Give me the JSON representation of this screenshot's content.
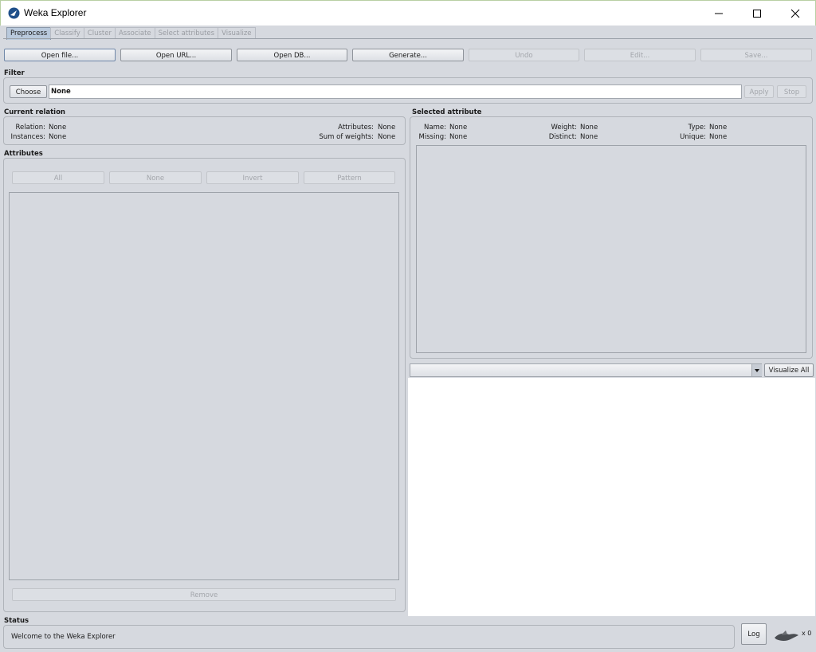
{
  "window": {
    "title": "Weka Explorer"
  },
  "tabs": [
    {
      "label": "Preprocess"
    },
    {
      "label": "Classify"
    },
    {
      "label": "Cluster"
    },
    {
      "label": "Associate"
    },
    {
      "label": "Select attributes"
    },
    {
      "label": "Visualize"
    }
  ],
  "toolbar": {
    "open_file": "Open file...",
    "open_url": "Open URL...",
    "open_db": "Open DB...",
    "generate": "Generate...",
    "undo": "Undo",
    "edit": "Edit...",
    "save": "Save..."
  },
  "filter": {
    "label": "Filter",
    "choose": "Choose",
    "value": "None",
    "apply": "Apply",
    "stop": "Stop"
  },
  "current_relation": {
    "label": "Current relation",
    "relation_label": "Relation:",
    "relation_value": "None",
    "instances_label": "Instances:",
    "instances_value": "None",
    "attributes_label": "Attributes:",
    "attributes_value": "None",
    "sow_label": "Sum of weights:",
    "sow_value": "None"
  },
  "attributes": {
    "label": "Attributes",
    "all": "All",
    "none": "None",
    "invert": "Invert",
    "pattern": "Pattern",
    "remove": "Remove"
  },
  "selected_attribute": {
    "label": "Selected attribute",
    "name_label": "Name:",
    "name_value": "None",
    "missing_label": "Missing:",
    "missing_value": "None",
    "weight_label": "Weight:",
    "weight_value": "None",
    "distinct_label": "Distinct:",
    "distinct_value": "None",
    "type_label": "Type:",
    "type_value": "None",
    "unique_label": "Unique:",
    "unique_value": "None"
  },
  "visualize": {
    "select_value": "",
    "visualize_all": "Visualize All"
  },
  "status": {
    "label": "Status",
    "message": "Welcome to the Weka Explorer",
    "log": "Log",
    "count": "x 0"
  },
  "icons": {
    "app": "weka-bird-icon",
    "minimize": "minimize-icon",
    "maximize": "maximize-icon",
    "close": "close-icon",
    "status": "weka-bird-icon"
  }
}
